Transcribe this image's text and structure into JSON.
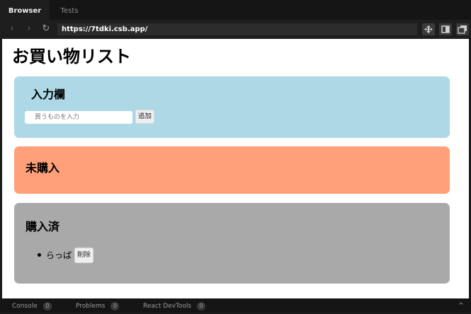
{
  "browser": {
    "tabs": [
      {
        "label": "Browser",
        "active": true
      },
      {
        "label": "Tests",
        "active": false
      }
    ],
    "url": "https://7tdki.csb.app/",
    "nav": {
      "back_icon": "‹",
      "forward_icon": "›",
      "reload_icon": "↻"
    }
  },
  "page": {
    "title": "お買い物リスト",
    "input_section": {
      "heading": "入力欄",
      "placeholder": "買うものを入力",
      "add_label": "追加"
    },
    "pending_section": {
      "heading": "未購入",
      "items": []
    },
    "done_section": {
      "heading": "購入済",
      "items": [
        {
          "text": "らっぱ",
          "delete_label": "削除"
        }
      ]
    }
  },
  "devtools": {
    "items": [
      {
        "label": "Console",
        "count": "0"
      },
      {
        "label": "Problems",
        "count": "0"
      },
      {
        "label": "React DevTools",
        "count": "0"
      }
    ],
    "caret": "^"
  },
  "colors": {
    "input_card": "#add8e6",
    "pending_card": "#ffa07a",
    "done_card": "#a9a9a9"
  }
}
